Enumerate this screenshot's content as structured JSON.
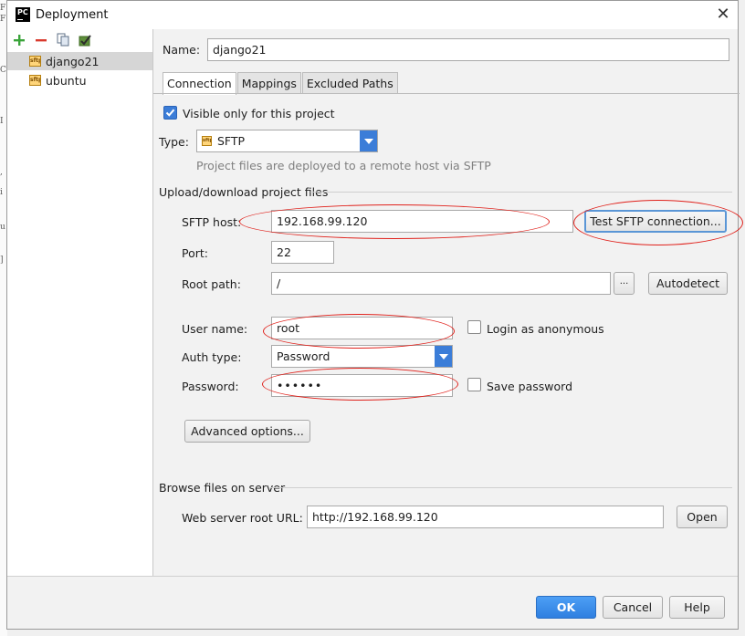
{
  "window": {
    "title": "Deployment",
    "app_icon_text": "PC"
  },
  "sidebar": {
    "toolbar": [
      "add-icon",
      "remove-icon",
      "copy-icon",
      "check-icon"
    ],
    "items": [
      {
        "label": "django21",
        "selected": true
      },
      {
        "label": "ubuntu",
        "selected": false
      }
    ]
  },
  "form": {
    "name_label": "Name:",
    "name_value": "django21",
    "tabs": [
      {
        "label": "Connection",
        "active": true
      },
      {
        "label": "Mappings",
        "active": false
      },
      {
        "label": "Excluded Paths",
        "active": false
      }
    ],
    "visible_only_label": "Visible only for this project",
    "visible_only_checked": true,
    "type_label": "Type:",
    "type_value": "SFTP",
    "type_note": "Project files are deployed to a remote host via SFTP",
    "upload_section": "Upload/download project files",
    "sftp_host_label": "SFTP host:",
    "sftp_host_value": "192.168.99.120",
    "test_button": "Test SFTP connection...",
    "port_label": "Port:",
    "port_value": "22",
    "root_path_label": "Root path:",
    "root_path_value": "/",
    "browse_button": "...",
    "autodetect_button": "Autodetect",
    "user_name_label": "User name:",
    "user_name_value": "root",
    "login_anonymous_label": "Login as anonymous",
    "login_anonymous_checked": false,
    "auth_type_label": "Auth type:",
    "auth_type_value": "Password",
    "password_label": "Password:",
    "password_value": "••••••",
    "save_password_label": "Save password",
    "save_password_checked": false,
    "advanced_button": "Advanced options...",
    "browse_section": "Browse files on server",
    "web_root_label": "Web server root URL:",
    "web_root_value": "http://192.168.99.120",
    "open_button": "Open"
  },
  "footer": {
    "ok": "OK",
    "cancel": "Cancel",
    "help": "Help"
  },
  "colors": {
    "accent": "#3b7dd8",
    "annotation": "#e0221c"
  }
}
